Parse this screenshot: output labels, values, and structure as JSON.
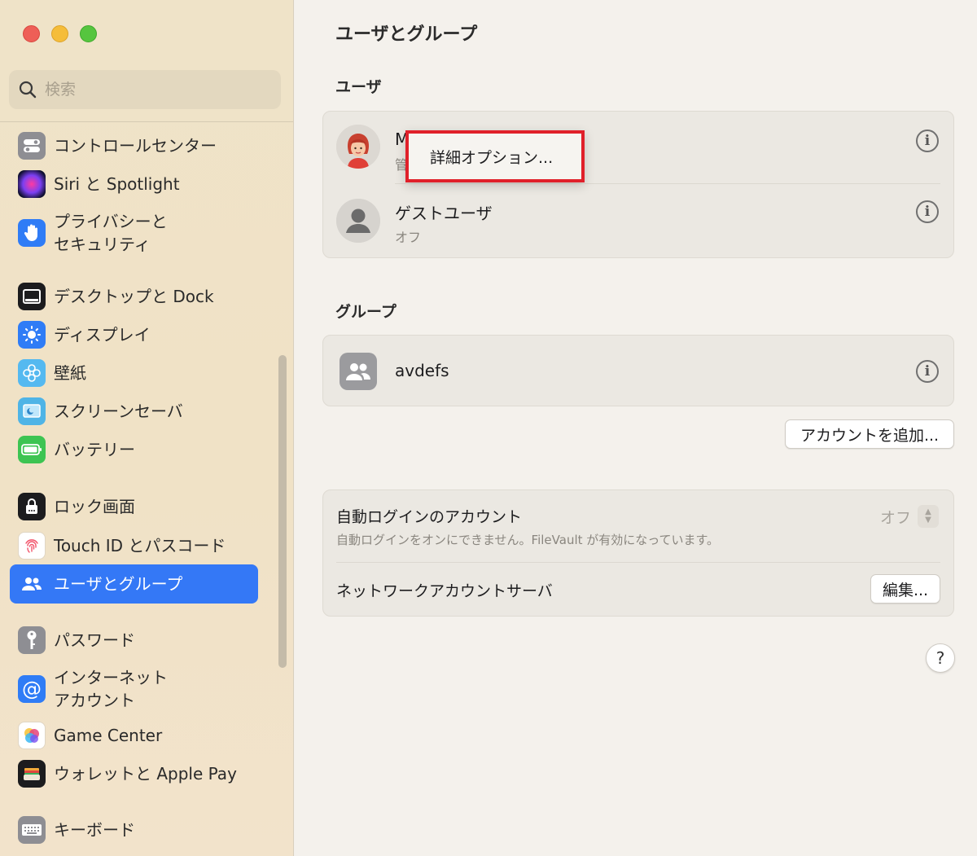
{
  "window": {
    "controls": [
      "close",
      "minimize",
      "zoom"
    ]
  },
  "search": {
    "placeholder": "検索"
  },
  "sidebar": {
    "items": [
      {
        "label": "コントロールセンター",
        "icon": "control-center-icon"
      },
      {
        "label": "Siri と Spotlight",
        "icon": "siri-icon"
      },
      {
        "label": "プライバシーと\nセキュリティ",
        "icon": "hand-icon"
      },
      {
        "label": "デスクトップと Dock",
        "icon": "dock-icon"
      },
      {
        "label": "ディスプレイ",
        "icon": "sun-icon"
      },
      {
        "label": "壁紙",
        "icon": "wallpaper-icon"
      },
      {
        "label": "スクリーンセーバ",
        "icon": "screensaver-icon"
      },
      {
        "label": "バッテリー",
        "icon": "battery-icon"
      },
      {
        "label": "ロック画面",
        "icon": "lock-icon"
      },
      {
        "label": "Touch ID とパスコード",
        "icon": "fingerprint-icon"
      },
      {
        "label": "ユーザとグループ",
        "icon": "users-icon",
        "active": true
      },
      {
        "label": "パスワード",
        "icon": "key-icon"
      },
      {
        "label": "インターネット\nアカウント",
        "icon": "at-icon"
      },
      {
        "label": "Game Center",
        "icon": "game-center-icon"
      },
      {
        "label": "ウォレットと Apple Pay",
        "icon": "wallet-icon"
      },
      {
        "label": "キーボード",
        "icon": "keyboard-icon"
      }
    ]
  },
  "main": {
    "title": "ユーザとグループ",
    "users_header": "ユーザ",
    "users": [
      {
        "name": "M",
        "role": "管",
        "avatar": "memoji-avatar"
      },
      {
        "name": "ゲストユーザ",
        "role": "オフ",
        "avatar": "guest-avatar"
      }
    ],
    "context_menu": {
      "item": "詳細オプション..."
    },
    "groups_header": "グループ",
    "groups": [
      {
        "name": "avdefs"
      }
    ],
    "add_account_button": "アカウントを追加...",
    "auto_login": {
      "label": "自動ログインのアカウント",
      "note": "自動ログインをオンにできません。FileVault が有効になっています。",
      "value": "オフ"
    },
    "network_server": {
      "label": "ネットワークアカウントサーバ",
      "button": "編集..."
    },
    "help": "?"
  },
  "colors": {
    "accent": "#3478f6",
    "highlight_border": "#e0202a"
  }
}
